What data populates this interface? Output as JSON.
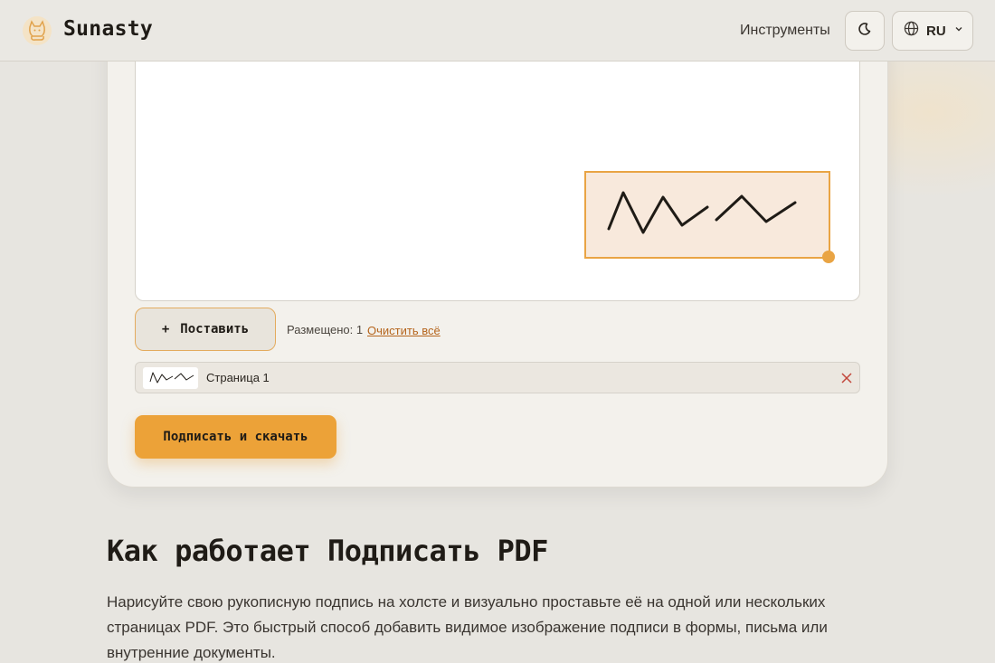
{
  "header": {
    "brand": "Sunasty",
    "nav_tools": "Инструменты",
    "lang": "RU",
    "icons": {
      "logo": "cat-logo-icon",
      "theme": "moon-icon",
      "lang": "globe-icon",
      "lang_caret": "chevron-down-icon"
    }
  },
  "editor": {
    "place_button_icon": "+",
    "place_button_label": "Поставить",
    "placed_label": "Размещено: 1",
    "clear_all": "Очистить всё",
    "placements": [
      {
        "page": "Страница 1"
      }
    ],
    "sign_button": "Подписать и скачать",
    "accent_color": "#e9a444"
  },
  "section": {
    "title": "Как работает Подписать PDF",
    "body": "Нарисуйте свою рукописную подпись на холсте и визуально проставьте её на одной или нескольких страницах PDF. Это быстрый способ добавить видимое изображение подписи в формы, письма или внутренние документы."
  }
}
